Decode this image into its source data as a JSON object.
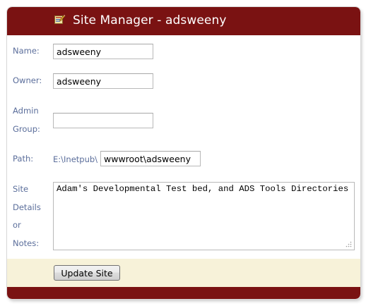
{
  "header": {
    "title": "Site Manager - adsweeny",
    "icon": "site-manager-icon"
  },
  "form": {
    "name": {
      "label": "Name:",
      "value": "adsweeny"
    },
    "owner": {
      "label": "Owner:",
      "value": "adsweeny"
    },
    "admin_group": {
      "label_line1": "Admin",
      "label_line2": "Group:",
      "value": ""
    },
    "path": {
      "label": "Path:",
      "prefix": "E:\\Inetpub\\",
      "value": "wwwroot\\adsweeny"
    },
    "notes": {
      "label_lines": [
        "Site",
        "Details",
        "or",
        "Notes:"
      ],
      "value": "Adam's Developmental Test bed, and ADS Tools Directories"
    }
  },
  "footer": {
    "update_button_label": "Update Site"
  },
  "colors": {
    "header_bg": "#7a1212",
    "label_text": "#5b6e9b",
    "footer_bg": "#f7f2d9"
  }
}
